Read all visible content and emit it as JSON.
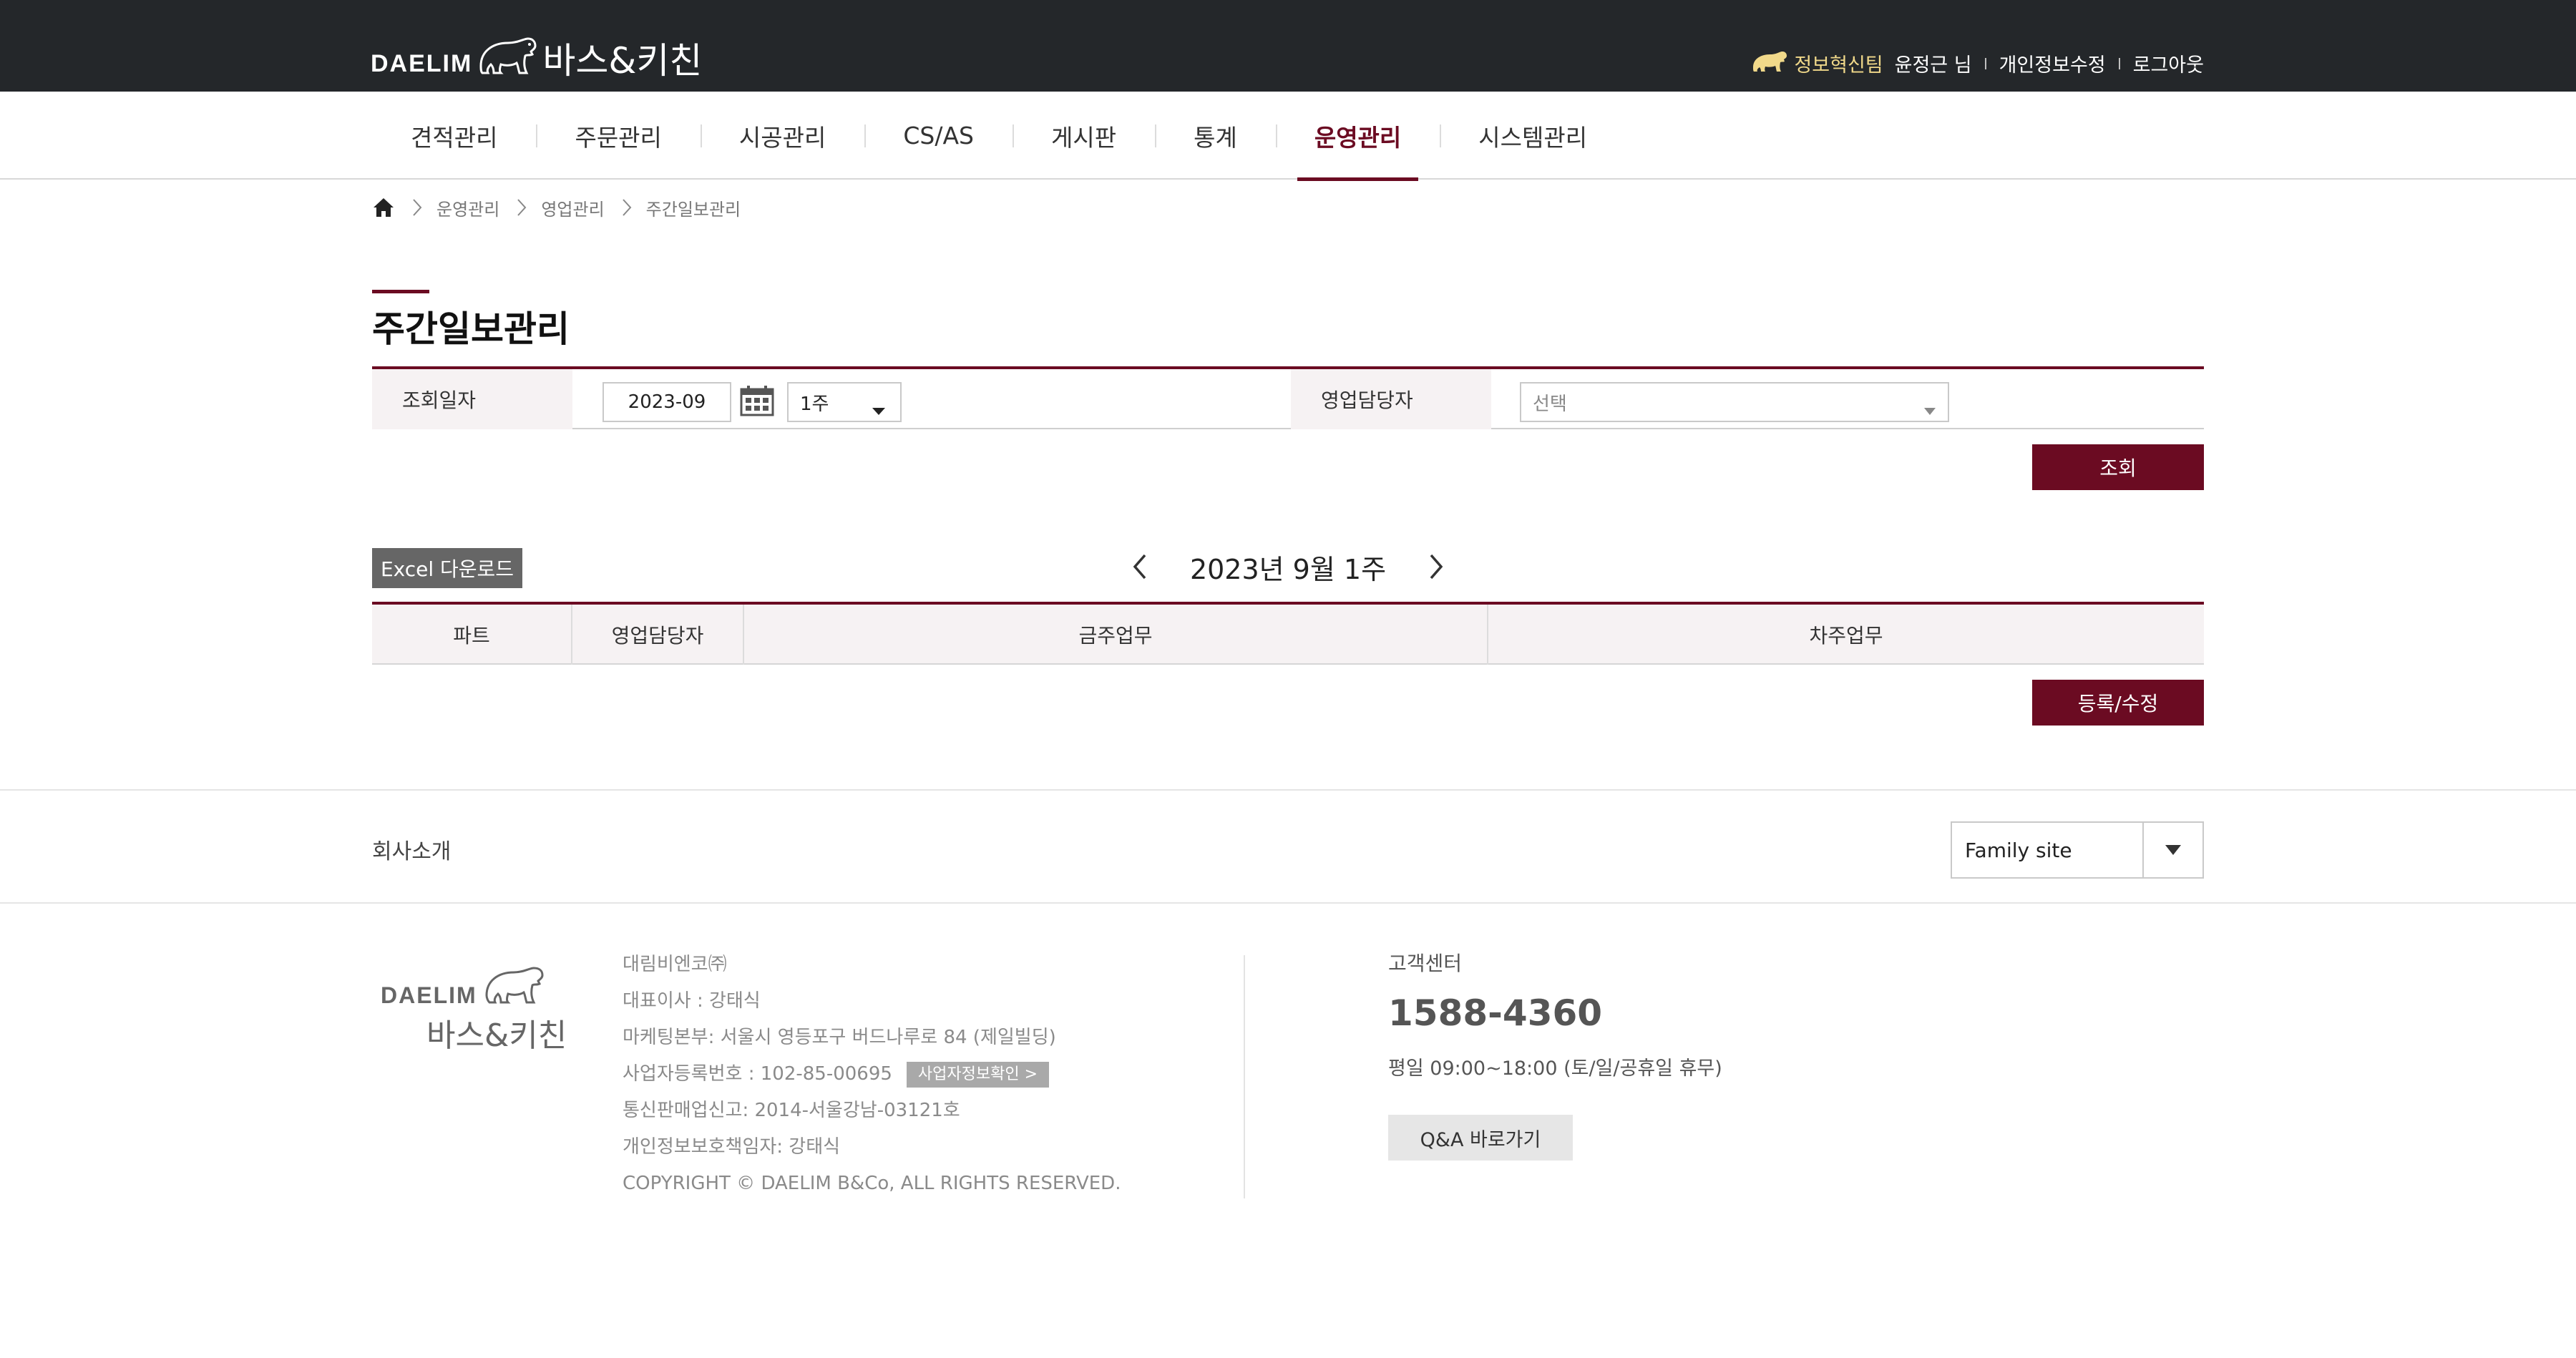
{
  "header": {
    "logo_brand": "DAELIM",
    "logo_name": "바스&키친",
    "team": "정보혁신팀",
    "user": "윤정근 님",
    "links": [
      "개인정보수정",
      "로그아웃"
    ]
  },
  "nav": {
    "items": [
      "견적관리",
      "주문관리",
      "시공관리",
      "CS/AS",
      "게시판",
      "통계",
      "운영관리",
      "시스템관리"
    ],
    "active": "운영관리"
  },
  "breadcrumb": [
    "운영관리",
    "영업관리",
    "주간일보관리"
  ],
  "page_title": "주간일보관리",
  "search": {
    "date_label": "조회일자",
    "date_value": "2023-09",
    "week_value": "1주",
    "sales_label": "영업담당자",
    "sales_placeholder": "선택",
    "search_button": "조회"
  },
  "toolbar": {
    "excel_button": "Excel 다운로드",
    "week_label": "2023년 9월 1주"
  },
  "table": {
    "columns": [
      "파트",
      "영업담당자",
      "금주업무",
      "차주업무"
    ],
    "rows": []
  },
  "save_button": "등록/수정",
  "footer": {
    "company_link": "회사소개",
    "family_site": "Family site",
    "logo_brand": "DAELIM",
    "logo_name": "바스&키친",
    "info": [
      "대림비엔코㈜",
      "대표이사 : 강태식",
      "마케팅본부: 서울시 영등포구 버드나루로 84 (제일빌딩)",
      "사업자등록번호 : 102-85-00695",
      "통신판매업신고: 2014-서울강남-03121호",
      "개인정보보호책임자: 강태식",
      "COPYRIGHT © DAELIM B&Co, ALL RIGHTS RESERVED."
    ],
    "biz_check": "사업자정보확인 >",
    "cs_title": "고객센터",
    "cs_phone": "1588-4360",
    "cs_hours": "평일 09:00~18:00 (토/일/공휴일 휴무)",
    "qa_button": "Q&A 바로가기"
  },
  "colors": {
    "accent": "#6b0b22",
    "header_bg": "#24272a",
    "team_text": "#f1d98a"
  }
}
